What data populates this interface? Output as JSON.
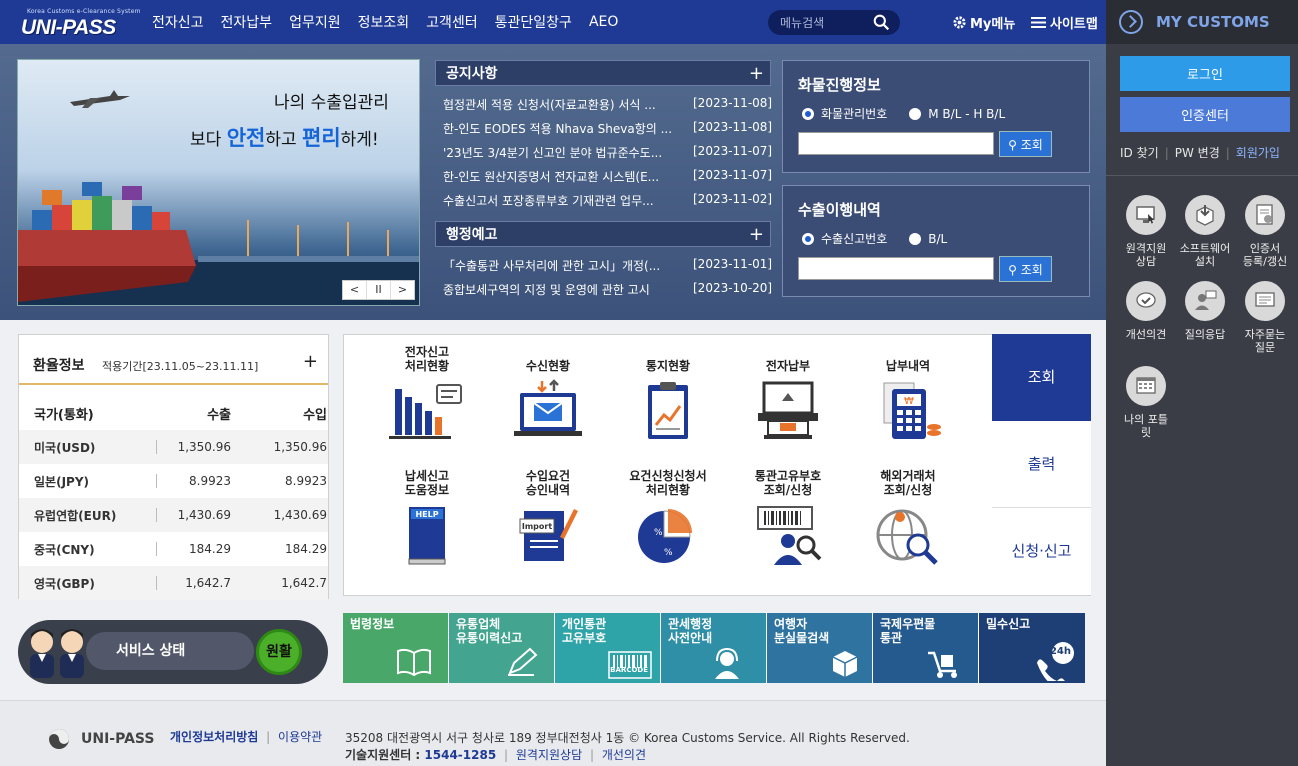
{
  "header": {
    "logo_sub": "Korea Customs e-Clearance System",
    "logo_main": "UNI-PASS",
    "nav": [
      "전자신고",
      "전자납부",
      "업무지원",
      "정보조회",
      "고객센터",
      "통관단일창구",
      "AEO"
    ],
    "search_placeholder": "메뉴검색",
    "mymenu": "My메뉴",
    "sitemap": "사이트맵"
  },
  "sidebar": {
    "title": "MY CUSTOMS",
    "login": "로그인",
    "cert": "인증센터",
    "links": [
      "ID 찾기",
      "PW 변경",
      "회원가입"
    ],
    "quick": [
      {
        "label": "원격지원\n상담",
        "icon": "monitor-icon"
      },
      {
        "label": "소프트웨어\n설치",
        "icon": "software-box-icon"
      },
      {
        "label": "인증서\n등록/갱신",
        "icon": "certificate-icon"
      },
      {
        "label": "개선의견",
        "icon": "speech-check-icon"
      },
      {
        "label": "질의응답",
        "icon": "qna-person-icon"
      },
      {
        "label": "자주묻는\n질문",
        "icon": "faq-icon"
      },
      {
        "label": "나의 포틀\n릿",
        "icon": "portlet-grid-icon"
      }
    ]
  },
  "banner": {
    "line1": "나의 수출입관리",
    "line2_pre": "보다 ",
    "line2_b1": "안전",
    "line2_mid": "하고 ",
    "line2_b2": "편리",
    "line2_post": "하게!",
    "controls": [
      "<",
      "II",
      ">"
    ]
  },
  "notice": {
    "title": "공지사항",
    "items": [
      {
        "title": "협정관세 적용 신청서(자료교환용) 서식 ...",
        "date": "[2023-11-08]"
      },
      {
        "title": "한-인도 EODES 적용 Nhava Sheva항의 ...",
        "date": "[2023-11-08]"
      },
      {
        "title": "'23년도 3/4분기 신고인 분야 법규준수도...",
        "date": "[2023-11-07]"
      },
      {
        "title": "한-인도 원산지증명서 전자교환 시스템(E...",
        "date": "[2023-11-07]"
      },
      {
        "title": "수출신고서 포장종류부호 기재관련 업무...",
        "date": "[2023-11-02]"
      }
    ]
  },
  "admin_notice": {
    "title": "행정예고",
    "items": [
      {
        "title": "「수출통관 사무처리에 관한 고시」개정(...",
        "date": "[2023-11-01]"
      },
      {
        "title": "종합보세구역의 지정 및 운영에 관한 고시",
        "date": "[2023-10-20]"
      }
    ]
  },
  "cargo": {
    "title": "화물진행정보",
    "radio1": "화물관리번호",
    "radio2": "M B/L - H B/L",
    "button": "조회"
  },
  "export": {
    "title": "수출이행내역",
    "radio1": "수출신고번호",
    "radio2": "B/L",
    "button": "조회"
  },
  "fx": {
    "title": "환율정보",
    "period": "적용기간[23.11.05~23.11.11]",
    "columns": [
      "국가(통화)",
      "수출",
      "수입"
    ],
    "rows": [
      {
        "country": "미국(USD)",
        "export": "1,350.96",
        "import": "1,350.96"
      },
      {
        "country": "일본(JPY)",
        "export": "8.9923",
        "import": "8.9923"
      },
      {
        "country": "유럽연합(EUR)",
        "export": "1,430.69",
        "import": "1,430.69"
      },
      {
        "country": "중국(CNY)",
        "export": "184.29",
        "import": "184.29"
      },
      {
        "country": "영국(GBP)",
        "export": "1,642.7",
        "import": "1,642.7"
      }
    ]
  },
  "services": [
    {
      "label": "전자신고\n처리현황",
      "icon": "bar-chart-icon"
    },
    {
      "label": "수신현황",
      "icon": "laptop-mail-icon"
    },
    {
      "label": "통지현황",
      "icon": "clipboard-chart-icon"
    },
    {
      "label": "전자납부",
      "icon": "atm-icon"
    },
    {
      "label": "납부내역",
      "icon": "calculator-icon"
    },
    {
      "label": "납세신고\n도움정보",
      "icon": "help-book-icon"
    },
    {
      "label": "수입요건\n승인내역",
      "icon": "import-doc-icon"
    },
    {
      "label": "요건신청신청서\n처리현황",
      "icon": "pie-chart-icon"
    },
    {
      "label": "통관고유부호\n조회/신청",
      "icon": "barcode-person-icon"
    },
    {
      "label": "해외거래처\n조회/신청",
      "icon": "globe-search-icon"
    }
  ],
  "service_tabs": [
    "조회",
    "출력",
    "신청·신고"
  ],
  "status": {
    "label": "서비스 상태",
    "value": "원활"
  },
  "tiles": [
    {
      "label": "법령정보",
      "color": "#4aa76a",
      "icon": "book-icon"
    },
    {
      "label": "유통업체\n유통이력신고",
      "color": "#43a490",
      "icon": "pen-icon"
    },
    {
      "label": "개인통관\n고유부호",
      "color": "#2ea3a8",
      "icon": "barcode-icon",
      "sub": "BARCODE"
    },
    {
      "label": "관세행정\n사전안내",
      "color": "#2e8fa6",
      "icon": "headset-icon"
    },
    {
      "label": "여행자\n분실물검색",
      "color": "#2f74a0",
      "icon": "parcel-icon"
    },
    {
      "label": "국제우편물\n통관",
      "color": "#255a8f",
      "icon": "cart-icon"
    },
    {
      "label": "밀수신고",
      "color": "#1e3f76",
      "icon": "phone24-icon",
      "sub": "24h"
    }
  ],
  "footer": {
    "logo": "UNI-PASS",
    "link1": "개인정보처리방침",
    "link2": "이용약관",
    "address": "35208 대전광역시 서구 청사로 189 정부대전청사 1동 © Korea Customs Service. All Rights Reserved.",
    "support_label": "기술지원센터 : ",
    "tel": "1544-1285",
    "remote": "원격지원상담",
    "feedback": "개선의견"
  },
  "colors": {
    "nav": "#1f3a94",
    "sidebar": "#3a3d45",
    "login": "#2d9be8",
    "accent_orange": "#e8742c"
  }
}
